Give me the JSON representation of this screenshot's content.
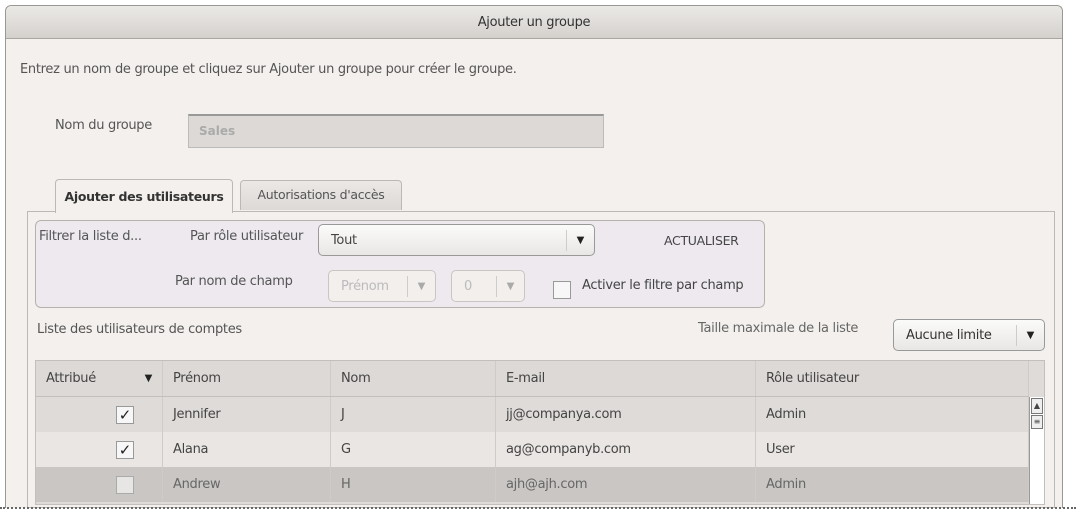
{
  "window": {
    "title": "Ajouter un groupe"
  },
  "instruction": "Entrez un nom de groupe et cliquez sur Ajouter un groupe pour créer le groupe.",
  "group_name": {
    "label": "Nom du groupe",
    "value": "Sales"
  },
  "tabs": [
    {
      "label": "Ajouter des utilisateurs",
      "active": true
    },
    {
      "label": "Autorisations d'accès",
      "active": false
    }
  ],
  "filter": {
    "title": "Filtrer la liste d...",
    "role_label": "Par rôle utilisateur",
    "role_value": "Tout",
    "refresh": "ACTUALISER",
    "field_label": "Par nom de champ",
    "field_value": "Prénom",
    "op_value": "0",
    "enable_label": "Activer le filtre par champ",
    "enable_checked": false
  },
  "list": {
    "title": "Liste des utilisateurs de comptes",
    "max_label": "Taille maximale de la liste",
    "max_value": "Aucune limite"
  },
  "table": {
    "columns": [
      "Attribué",
      "Prénom",
      "Nom",
      "E-mail",
      "Rôle utilisateur"
    ],
    "rows": [
      {
        "assigned": true,
        "first": "Jennifer",
        "last": "J",
        "email": "jj@companya.com",
        "role": "Admin"
      },
      {
        "assigned": true,
        "first": "Alana",
        "last": "G",
        "email": "ag@companyb.com",
        "role": "User"
      },
      {
        "assigned": false,
        "first": "Andrew",
        "last": "H",
        "email": "ajh@ajh.com",
        "role": "Admin"
      }
    ]
  }
}
